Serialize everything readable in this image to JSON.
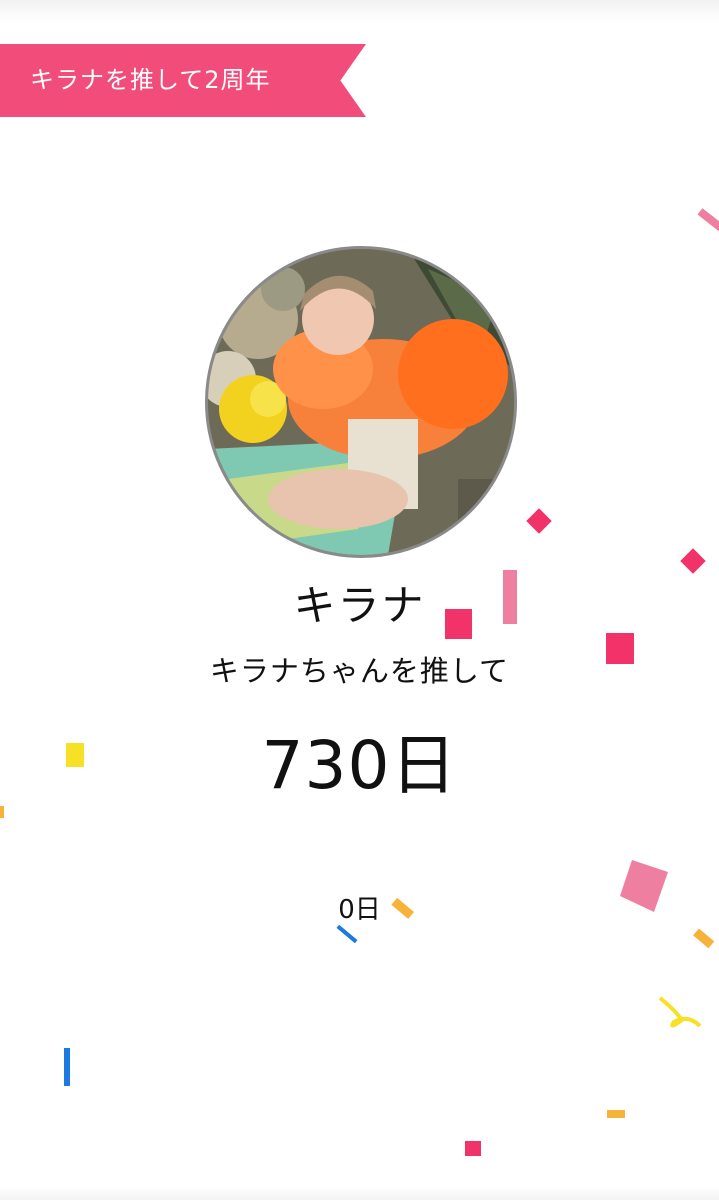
{
  "banner": {
    "text": "キラナを推して2周年",
    "color": "#f24d7a"
  },
  "profile": {
    "name": "キラナ",
    "avatar_description_icon": "profile-photo"
  },
  "stats": {
    "subtitle": "キラナちゃんを推して",
    "days_label": "730日",
    "counter_label": "0日"
  },
  "colors": {
    "confetti_pink": "#f2336a",
    "confetti_light_pink": "#ef7fa1",
    "confetti_yellow": "#f6e126",
    "confetti_orange": "#f7b23a",
    "confetti_blue": "#1a7ae0"
  }
}
